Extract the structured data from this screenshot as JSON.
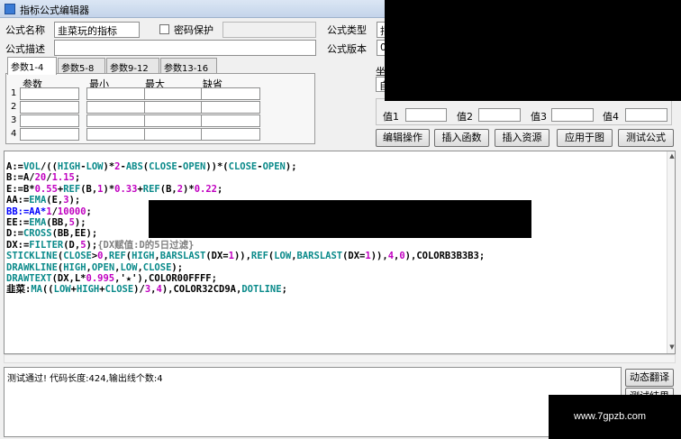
{
  "window": {
    "title": "指标公式编辑器"
  },
  "form": {
    "name_label": "公式名称",
    "name_value": "韭菜玩的指标",
    "password_label": "密码保护",
    "desc_label": "公式描述",
    "desc_value": "",
    "type_label": "公式类型",
    "type_value": "指",
    "version_label": "公式版本",
    "version_value": "0"
  },
  "tabs": [
    {
      "label": "参数1-4"
    },
    {
      "label": "参数5-8"
    },
    {
      "label": "参数9-12"
    },
    {
      "label": "参数13-16"
    }
  ],
  "params": {
    "headers": [
      "参数",
      "最小",
      "最大",
      "缺省"
    ],
    "rows": [
      "1",
      "2",
      "3",
      "4"
    ]
  },
  "right_panel": {
    "partial_label": "坐",
    "partial_field": "自",
    "value_labels": [
      "值1",
      "值2",
      "值3",
      "值4"
    ]
  },
  "buttons": {
    "edit_ops": "编辑操作",
    "insert_func": "插入函数",
    "insert_resource": "插入资源",
    "apply_to_chart": "应用于图",
    "test_formula": "测试公式",
    "dynamic_translate": "动态翻译",
    "test_result": "测试结果"
  },
  "code_lines": [
    [
      {
        "t": "A:=",
        "c": "#000000"
      },
      {
        "t": "VOL",
        "c": "#0a8a8a"
      },
      {
        "t": "/((",
        "c": "#000000"
      },
      {
        "t": "HIGH",
        "c": "#0a8a8a"
      },
      {
        "t": "-",
        "c": "#000000"
      },
      {
        "t": "LOW",
        "c": "#0a8a8a"
      },
      {
        "t": ")*",
        "c": "#000000"
      },
      {
        "t": "2",
        "c": "#c000c0"
      },
      {
        "t": "-",
        "c": "#000000"
      },
      {
        "t": "ABS",
        "c": "#0a8a8a"
      },
      {
        "t": "(",
        "c": "#000000"
      },
      {
        "t": "CLOSE",
        "c": "#0a8a8a"
      },
      {
        "t": "-",
        "c": "#000000"
      },
      {
        "t": "OPEN",
        "c": "#0a8a8a"
      },
      {
        "t": "))*(",
        "c": "#000000"
      },
      {
        "t": "CLOSE",
        "c": "#0a8a8a"
      },
      {
        "t": "-",
        "c": "#000000"
      },
      {
        "t": "OPEN",
        "c": "#0a8a8a"
      },
      {
        "t": ");",
        "c": "#000000"
      }
    ],
    [
      {
        "t": "B:=A/",
        "c": "#000000"
      },
      {
        "t": "20",
        "c": "#c000c0"
      },
      {
        "t": "/",
        "c": "#000000"
      },
      {
        "t": "1.15",
        "c": "#c000c0"
      },
      {
        "t": ";",
        "c": "#000000"
      }
    ],
    [
      {
        "t": "E:=B*",
        "c": "#000000"
      },
      {
        "t": "0.55",
        "c": "#c000c0"
      },
      {
        "t": "+",
        "c": "#000000"
      },
      {
        "t": "REF",
        "c": "#0a8a8a"
      },
      {
        "t": "(B,",
        "c": "#000000"
      },
      {
        "t": "1",
        "c": "#c000c0"
      },
      {
        "t": ")*",
        "c": "#000000"
      },
      {
        "t": "0.33",
        "c": "#c000c0"
      },
      {
        "t": "+",
        "c": "#000000"
      },
      {
        "t": "REF",
        "c": "#0a8a8a"
      },
      {
        "t": "(B,",
        "c": "#000000"
      },
      {
        "t": "2",
        "c": "#c000c0"
      },
      {
        "t": ")*",
        "c": "#000000"
      },
      {
        "t": "0.22",
        "c": "#c000c0"
      },
      {
        "t": ";",
        "c": "#000000"
      }
    ],
    [
      {
        "t": "AA:=",
        "c": "#000000"
      },
      {
        "t": "EMA",
        "c": "#0a8a8a"
      },
      {
        "t": "(E,",
        "c": "#000000"
      },
      {
        "t": "3",
        "c": "#c000c0"
      },
      {
        "t": ");",
        "c": "#000000"
      }
    ],
    [
      {
        "t": "BB:=AA*",
        "c": "#0000ff"
      },
      {
        "t": "1",
        "c": "#c000c0"
      },
      {
        "t": "/",
        "c": "#000000"
      },
      {
        "t": "10000",
        "c": "#c000c0"
      },
      {
        "t": ";",
        "c": "#000000"
      }
    ],
    [
      {
        "t": "EE:=",
        "c": "#000000"
      },
      {
        "t": "EMA",
        "c": "#0a8a8a"
      },
      {
        "t": "(BB,",
        "c": "#000000"
      },
      {
        "t": "5",
        "c": "#c000c0"
      },
      {
        "t": ");",
        "c": "#000000"
      }
    ],
    [
      {
        "t": "D:=",
        "c": "#000000"
      },
      {
        "t": "CROSS",
        "c": "#0a8a8a"
      },
      {
        "t": "(BB,EE);",
        "c": "#000000"
      }
    ],
    [
      {
        "t": "DX:=",
        "c": "#000000"
      },
      {
        "t": "FILTER",
        "c": "#0a8a8a"
      },
      {
        "t": "(D,",
        "c": "#000000"
      },
      {
        "t": "5",
        "c": "#c000c0"
      },
      {
        "t": ");",
        "c": "#000000"
      },
      {
        "t": "{DX赋值:D的5日过滤}",
        "c": "#808080"
      }
    ],
    [
      {
        "t": "STICKLINE",
        "c": "#0a8a8a"
      },
      {
        "t": "(",
        "c": "#000000"
      },
      {
        "t": "CLOSE",
        "c": "#0a8a8a"
      },
      {
        "t": ">",
        "c": "#000000"
      },
      {
        "t": "0",
        "c": "#c000c0"
      },
      {
        "t": ",",
        "c": "#000000"
      },
      {
        "t": "REF",
        "c": "#0a8a8a"
      },
      {
        "t": "(",
        "c": "#000000"
      },
      {
        "t": "HIGH",
        "c": "#0a8a8a"
      },
      {
        "t": ",",
        "c": "#000000"
      },
      {
        "t": "BARSLAST",
        "c": "#0a8a8a"
      },
      {
        "t": "(DX=",
        "c": "#000000"
      },
      {
        "t": "1",
        "c": "#c000c0"
      },
      {
        "t": ")),",
        "c": "#000000"
      },
      {
        "t": "REF",
        "c": "#0a8a8a"
      },
      {
        "t": "(",
        "c": "#000000"
      },
      {
        "t": "LOW",
        "c": "#0a8a8a"
      },
      {
        "t": ",",
        "c": "#000000"
      },
      {
        "t": "BARSLAST",
        "c": "#0a8a8a"
      },
      {
        "t": "(DX=",
        "c": "#000000"
      },
      {
        "t": "1",
        "c": "#c000c0"
      },
      {
        "t": ")),",
        "c": "#000000"
      },
      {
        "t": "4",
        "c": "#c000c0"
      },
      {
        "t": ",",
        "c": "#000000"
      },
      {
        "t": "0",
        "c": "#c000c0"
      },
      {
        "t": "),COLORB3B3B3;",
        "c": "#000000"
      }
    ],
    [
      {
        "t": "DRAWKLINE",
        "c": "#0a8a8a"
      },
      {
        "t": "(",
        "c": "#000000"
      },
      {
        "t": "HIGH",
        "c": "#0a8a8a"
      },
      {
        "t": ",",
        "c": "#000000"
      },
      {
        "t": "OPEN",
        "c": "#0a8a8a"
      },
      {
        "t": ",",
        "c": "#000000"
      },
      {
        "t": "LOW",
        "c": "#0a8a8a"
      },
      {
        "t": ",",
        "c": "#000000"
      },
      {
        "t": "CLOSE",
        "c": "#0a8a8a"
      },
      {
        "t": ");",
        "c": "#000000"
      }
    ],
    [
      {
        "t": "DRAWTEXT",
        "c": "#0a8a8a"
      },
      {
        "t": "(DX,L*",
        "c": "#000000"
      },
      {
        "t": "0.995",
        "c": "#c000c0"
      },
      {
        "t": ",'★'),COLOR00FFFF;",
        "c": "#000000"
      }
    ],
    [
      {
        "t": "韭菜:",
        "c": "#000000"
      },
      {
        "t": "MA",
        "c": "#0a8a8a"
      },
      {
        "t": "((",
        "c": "#000000"
      },
      {
        "t": "LOW",
        "c": "#0a8a8a"
      },
      {
        "t": "+",
        "c": "#000000"
      },
      {
        "t": "HIGH",
        "c": "#0a8a8a"
      },
      {
        "t": "+",
        "c": "#000000"
      },
      {
        "t": "CLOSE",
        "c": "#0a8a8a"
      },
      {
        "t": ")/",
        "c": "#000000"
      },
      {
        "t": "3",
        "c": "#c000c0"
      },
      {
        "t": ",",
        "c": "#000000"
      },
      {
        "t": "4",
        "c": "#c000c0"
      },
      {
        "t": "),COLOR32CD9A,",
        "c": "#000000"
      },
      {
        "t": "DOTLINE",
        "c": "#0a8a8a"
      },
      {
        "t": ";",
        "c": "#000000"
      }
    ]
  ],
  "output": {
    "message": "测试通过! 代码长度:424,输出线个数:4"
  },
  "watermark": {
    "text": "www.7gpzb.com"
  }
}
